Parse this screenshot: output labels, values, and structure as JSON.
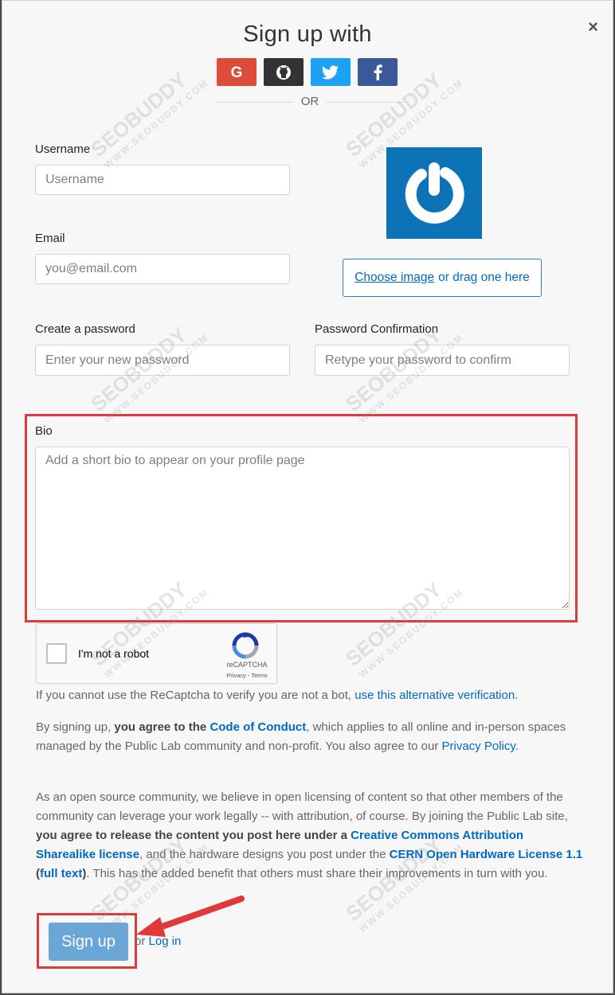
{
  "modal": {
    "title": "Sign up with",
    "close_symbol": "×",
    "or_divider": "OR",
    "social": [
      {
        "name": "google",
        "icon": "google-icon",
        "color": "#dd4b39"
      },
      {
        "name": "github",
        "icon": "github-icon",
        "color": "#333333"
      },
      {
        "name": "twitter",
        "icon": "twitter-icon",
        "color": "#1da1f2"
      },
      {
        "name": "facebook",
        "icon": "facebook-icon",
        "color": "#3b5998"
      }
    ]
  },
  "form": {
    "username": {
      "label": "Username",
      "placeholder": "Username"
    },
    "email": {
      "label": "Email",
      "placeholder": "you@email.com"
    },
    "password": {
      "label": "Create a password",
      "placeholder": "Enter your new password"
    },
    "password_confirm": {
      "label": "Password Confirmation",
      "placeholder": "Retype your password to confirm"
    },
    "bio": {
      "label": "Bio",
      "placeholder": "Add a short bio to appear on your profile page"
    },
    "avatar": {
      "choose_link": "Choose image",
      "choose_rest": "or drag one here"
    }
  },
  "recaptcha": {
    "label": "I'm not a robot",
    "brand": "reCAPTCHA",
    "terms": "Privacy - Terms",
    "alt_text": "If you cannot use the ReCaptcha to verify you are not a bot,",
    "alt_link": "use this alternative verification"
  },
  "legal": {
    "p1_a": "By signing up,",
    "p1_b": "you agree to the",
    "p1_link": "Code of Conduct",
    "p1_c": ", which applies to all online and in-person spaces managed by the Public Lab community and non-profit. You also agree to our",
    "p1_link2": "Privacy Policy",
    "p2_a": "As an open source community, we believe in open licensing of content so that other members of the community can leverage your work legally -- with attribution, of course. By joining the Public Lab site,",
    "p2_b": "you agree to release the content you post here under a",
    "p2_link1": "Creative Commons Attribution Sharealike license",
    "p2_c": ", and the hardware designs you post under the",
    "p2_link2": "CERN Open Hardware License 1.1",
    "p2_link3": "full text",
    "p2_d": ". This has the added benefit that others must share their improvements in turn with you."
  },
  "actions": {
    "signup": "Sign up",
    "or": "or",
    "login": "Log in"
  },
  "watermark": {
    "brand": "SEOBUDDY",
    "url": "WWW.SEOBUDDY.COM"
  },
  "colors": {
    "highlight": "#e0393c",
    "link": "#0069c2",
    "button": "#6aa6d6"
  }
}
